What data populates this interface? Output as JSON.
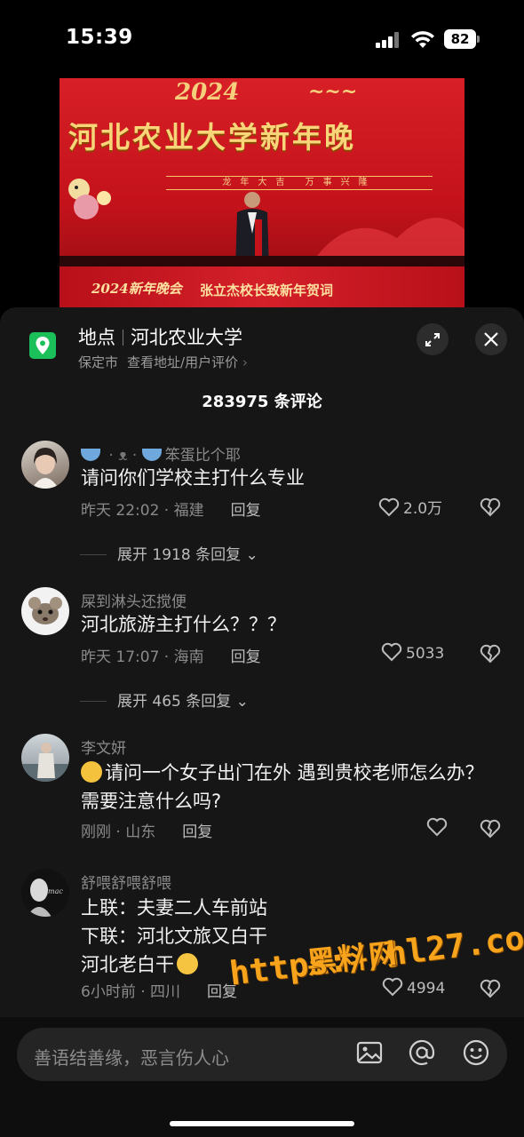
{
  "status_bar": {
    "time": "15:39",
    "battery": "82"
  },
  "video": {
    "title": "河北农业大学新年晚",
    "slogan": "龙年大吉 万事兴隆",
    "footer_left": "2024新年晚会",
    "footer_right": "张立杰校长致新年贺词"
  },
  "location": {
    "label": "地点",
    "name": "河北农业大学",
    "city": "保定市",
    "link": "查看地址/用户评价"
  },
  "comment_count": "283975 条评论",
  "comments": [
    {
      "name": "笨蛋比个耶",
      "text": "请问你们学校主打什么专业",
      "meta": "昨天 22:02 · 福建",
      "reply": "回复",
      "likes": "2.0万",
      "expand": "展开 1918 条回复"
    },
    {
      "name": "屎到淋头还搅便",
      "text": "河北旅游主打什么？？？",
      "meta": "昨天 17:07 · 海南",
      "reply": "回复",
      "likes": "5033",
      "expand": "展开 465 条回复"
    },
    {
      "name": "李文妍",
      "text": "请问一个女子出门在外 遇到贵校老师怎么办？需要注意什么吗?",
      "meta": "刚刚 · 山东",
      "reply": "回复",
      "likes": ""
    },
    {
      "name": "舒喂舒喂舒喂",
      "line1": "上联：夫妻二人车前站",
      "line2": "下联：河北文旅又白干",
      "line3": "河北老白干",
      "meta": "6小时前 · 四川",
      "reply": "回复",
      "likes": "4994"
    }
  ],
  "input": {
    "placeholder": "善语结善缘，恶言伤人心"
  },
  "watermark": {
    "line1": "黑料网",
    "line2": "https://hl27.co"
  },
  "colors": {
    "accent_green": "#1cc05a",
    "sheet_bg": "#161616",
    "watermark": "#f7a31b"
  }
}
